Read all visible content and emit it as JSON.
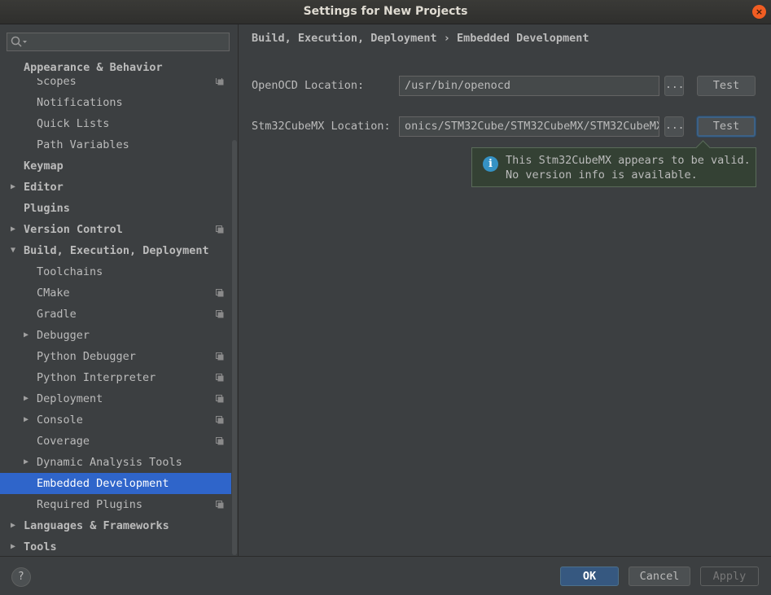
{
  "window": {
    "title": "Settings for New Projects",
    "close_glyph": "×"
  },
  "search": {
    "placeholder": "",
    "value": ""
  },
  "tree": {
    "items": [
      {
        "label": "Appearance & Behavior",
        "level": 0,
        "bold": true,
        "expandable": false,
        "expanded": false,
        "copy": false,
        "selected": false
      },
      {
        "label": "Scopes",
        "level": 1,
        "bold": false,
        "expandable": false,
        "expanded": false,
        "copy": true,
        "selected": false
      },
      {
        "label": "Notifications",
        "level": 1,
        "bold": false,
        "expandable": false,
        "expanded": false,
        "copy": false,
        "selected": false
      },
      {
        "label": "Quick Lists",
        "level": 1,
        "bold": false,
        "expandable": false,
        "expanded": false,
        "copy": false,
        "selected": false
      },
      {
        "label": "Path Variables",
        "level": 1,
        "bold": false,
        "expandable": false,
        "expanded": false,
        "copy": false,
        "selected": false
      },
      {
        "label": "Keymap",
        "level": 0,
        "bold": true,
        "expandable": false,
        "expanded": false,
        "copy": false,
        "selected": false
      },
      {
        "label": "Editor",
        "level": 0,
        "bold": true,
        "expandable": true,
        "expanded": false,
        "copy": false,
        "selected": false
      },
      {
        "label": "Plugins",
        "level": 0,
        "bold": true,
        "expandable": false,
        "expanded": false,
        "copy": false,
        "selected": false
      },
      {
        "label": "Version Control",
        "level": 0,
        "bold": true,
        "expandable": true,
        "expanded": false,
        "copy": true,
        "selected": false
      },
      {
        "label": "Build, Execution, Deployment",
        "level": 0,
        "bold": true,
        "expandable": true,
        "expanded": true,
        "copy": false,
        "selected": false
      },
      {
        "label": "Toolchains",
        "level": 1,
        "bold": false,
        "expandable": false,
        "expanded": false,
        "copy": false,
        "selected": false
      },
      {
        "label": "CMake",
        "level": 1,
        "bold": false,
        "expandable": false,
        "expanded": false,
        "copy": true,
        "selected": false
      },
      {
        "label": "Gradle",
        "level": 1,
        "bold": false,
        "expandable": false,
        "expanded": false,
        "copy": true,
        "selected": false
      },
      {
        "label": "Debugger",
        "level": 1,
        "bold": false,
        "expandable": true,
        "expanded": false,
        "copy": false,
        "selected": false
      },
      {
        "label": "Python Debugger",
        "level": 1,
        "bold": false,
        "expandable": false,
        "expanded": false,
        "copy": true,
        "selected": false
      },
      {
        "label": "Python Interpreter",
        "level": 1,
        "bold": false,
        "expandable": false,
        "expanded": false,
        "copy": true,
        "selected": false
      },
      {
        "label": "Deployment",
        "level": 1,
        "bold": false,
        "expandable": true,
        "expanded": false,
        "copy": true,
        "selected": false
      },
      {
        "label": "Console",
        "level": 1,
        "bold": false,
        "expandable": true,
        "expanded": false,
        "copy": true,
        "selected": false
      },
      {
        "label": "Coverage",
        "level": 1,
        "bold": false,
        "expandable": false,
        "expanded": false,
        "copy": true,
        "selected": false
      },
      {
        "label": "Dynamic Analysis Tools",
        "level": 1,
        "bold": false,
        "expandable": true,
        "expanded": false,
        "copy": false,
        "selected": false
      },
      {
        "label": "Embedded Development",
        "level": 1,
        "bold": false,
        "expandable": false,
        "expanded": false,
        "copy": false,
        "selected": true
      },
      {
        "label": "Required Plugins",
        "level": 1,
        "bold": false,
        "expandable": false,
        "expanded": false,
        "copy": true,
        "selected": false
      },
      {
        "label": "Languages & Frameworks",
        "level": 0,
        "bold": true,
        "expandable": true,
        "expanded": false,
        "copy": false,
        "selected": false
      },
      {
        "label": "Tools",
        "level": 0,
        "bold": true,
        "expandable": true,
        "expanded": false,
        "copy": false,
        "selected": false
      }
    ]
  },
  "main": {
    "breadcrumb": "Build, Execution, Deployment › Embedded Development",
    "openocd": {
      "label": "OpenOCD Location:",
      "value": "/usr/bin/openocd",
      "browse": "...",
      "test": "Test"
    },
    "cubemx": {
      "label": "Stm32CubeMX Location:",
      "value": "onics/STM32Cube/STM32CubeMX/STM32CubeMX",
      "browse": "...",
      "test": "Test"
    },
    "tooltip": {
      "line1": "This Stm32CubeMX appears to be valid.",
      "line2": "No version info is available."
    }
  },
  "footer": {
    "help": "?",
    "ok": "OK",
    "cancel": "Cancel",
    "apply": "Apply"
  },
  "colors": {
    "selection": "#2f65ca",
    "ok_button": "#365880",
    "tooltip_bg": "#344134",
    "info_icon": "#3592c4",
    "close_button": "#f15d22"
  }
}
